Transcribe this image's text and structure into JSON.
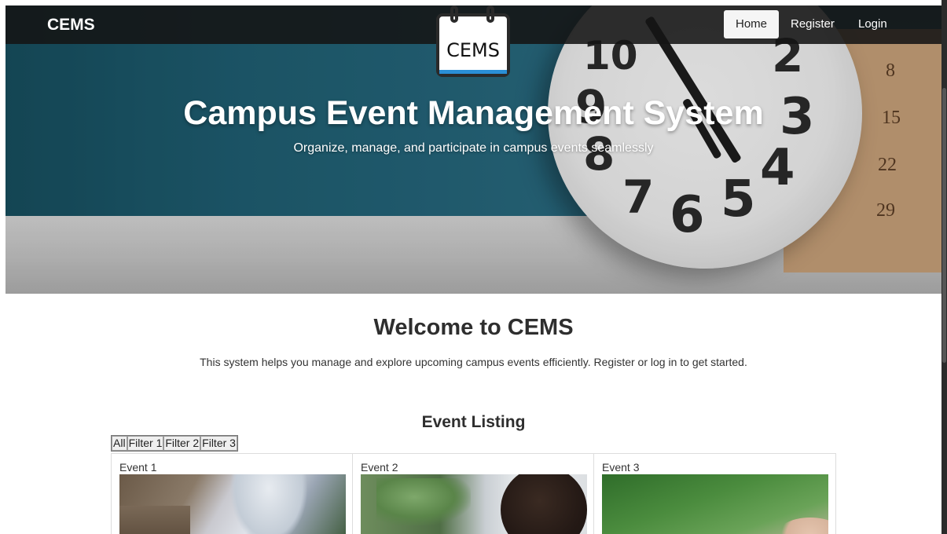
{
  "navbar": {
    "brand": "CEMS",
    "links": [
      {
        "label": "Home",
        "active": true
      },
      {
        "label": "Register",
        "active": false
      },
      {
        "label": "Login",
        "active": false
      }
    ]
  },
  "hero": {
    "logo_text": "CEMS",
    "title": "Campus Event Management System",
    "subtitle": "Organize, manage, and participate in campus events seamlessly",
    "clock_numbers": [
      "10",
      "2",
      "9",
      "3",
      "8",
      "4",
      "7",
      "6",
      "5"
    ],
    "calendar_numbers": [
      "8",
      "15",
      "22",
      "29"
    ]
  },
  "welcome": {
    "title": "Welcome to CEMS",
    "text": "This system helps you manage and explore upcoming campus events efficiently. Register or log in to get started."
  },
  "event_listing": {
    "title": "Event Listing",
    "filters": [
      "All",
      "Filter 1",
      "Filter 2",
      "Filter 3"
    ],
    "events": [
      {
        "title": "Event 1"
      },
      {
        "title": "Event 2"
      },
      {
        "title": "Event 3"
      }
    ]
  },
  "colors": {
    "navbar_bg": "#141414",
    "logo_accent": "#2a8fd6",
    "hero_wall": "#1f5f73"
  }
}
